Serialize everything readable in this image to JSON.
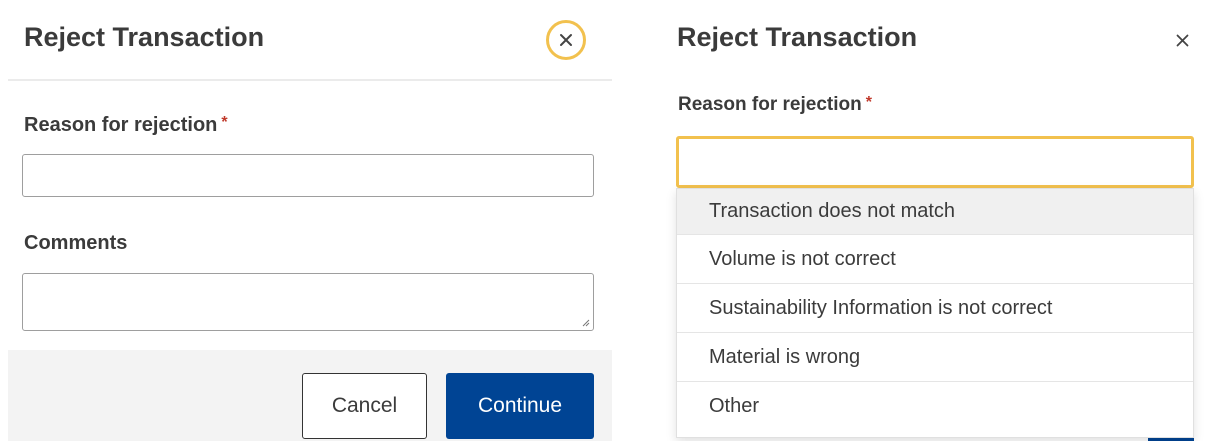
{
  "left_dialog": {
    "title": "Reject Transaction",
    "reason_label": "Reason for rejection",
    "required_marker": "*",
    "reason_value": "",
    "comments_label": "Comments",
    "comments_value": "",
    "cancel_label": "Cancel",
    "continue_label": "Continue",
    "close_icon": "close-icon"
  },
  "right_dialog": {
    "title": "Reject Transaction",
    "reason_label": "Reason for rejection",
    "required_marker": "*",
    "reason_value": "",
    "close_icon": "close-icon",
    "options": [
      "Transaction does not match",
      "Volume is not correct",
      "Sustainability Information is not correct",
      "Material is wrong",
      "Other"
    ]
  },
  "colors": {
    "primary": "#004494",
    "focus_ring": "#f2c14e",
    "required": "#c0392b",
    "footer_bg": "#f3f3f3",
    "highlight_bg": "#f0f0f0"
  }
}
